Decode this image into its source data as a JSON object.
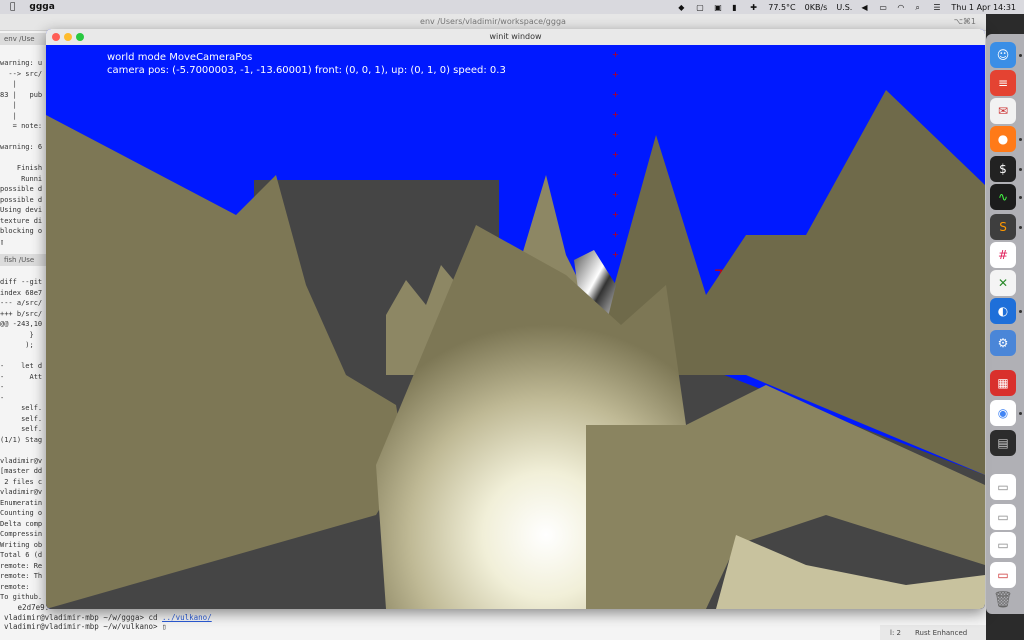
{
  "menubar": {
    "app_name": "ggga",
    "temperature": "77.5°C",
    "network": "0KB/s",
    "input_source": "U.S.",
    "datetime": "Thu 1 Apr 14:31"
  },
  "terminal": {
    "title": "env /Users/vladimir/workspace/ggga",
    "shortcut": "⌥⌘1",
    "tab_top": "env /Use",
    "tab_mid": "fish /Use",
    "pane_top_text": "warning: u\n  --> src/\n   |\n83 |   pub\n   |\n   |\n   = note:\n\nwarning: 6\n\n    Finish\n     Runni\npossible d\npossible d\nUsing devi\ntexture di\nblocking o\n▯",
    "pane_mid_text": "diff --git\nindex 68e7\n--- a/src/\n+++ b/src/\n@@ -243,10\n       }\n      );\n\n-    let d\n-      Att\n-\n-\n     self.\n     self.\n     self.\n(1/1) Stag\n\nvladimir@v\n[master dd\n 2 files c\nvladimir@v\nEnumeratin\nCounting o\nDelta comp\nCompressin\nWriting ob\nTotal 6 (d\nremote: Re\nremote: Th\nremote:\nTo github.",
    "line_hash": "   e2d7e9.",
    "line_prompt1": "vladimir@vladimir-mbp ~/w/ggga> cd ",
    "line_cmd_link": "../vulkano/",
    "line_prompt2": "vladimir@vladimir-mbp ~/w/vulkano> ▯",
    "status_col": "l: 2",
    "status_lang": "Rust Enhanced"
  },
  "winit": {
    "title": "winit window",
    "hud_line1": "world mode MoveCameraPos",
    "hud_line2": "camera pos: (-5.7000003, -1, -13.60001) front: (0, 0, 1), up: (0, 1, 0) speed: 0.3"
  },
  "scene": {
    "sky_color": "#0019ff",
    "terrain_color": "#7a7452",
    "floor_color": "#454545",
    "marker_color": "#cc0000",
    "marker_digits": [
      "7",
      "8"
    ]
  },
  "dock": {
    "icons": [
      "finder-icon",
      "todoist-icon",
      "mail-icon",
      "firefox-icon",
      "terminal-icon",
      "activity-monitor-icon",
      "sublime-text-icon",
      "slack-icon",
      "xcode-tools-icon",
      "safari-icon",
      "settings-icon",
      "fantastical-icon",
      "chrome-icon",
      "console-icon",
      "document-icon",
      "document-icon",
      "document-icon",
      "document-icon",
      "trash-icon"
    ]
  }
}
